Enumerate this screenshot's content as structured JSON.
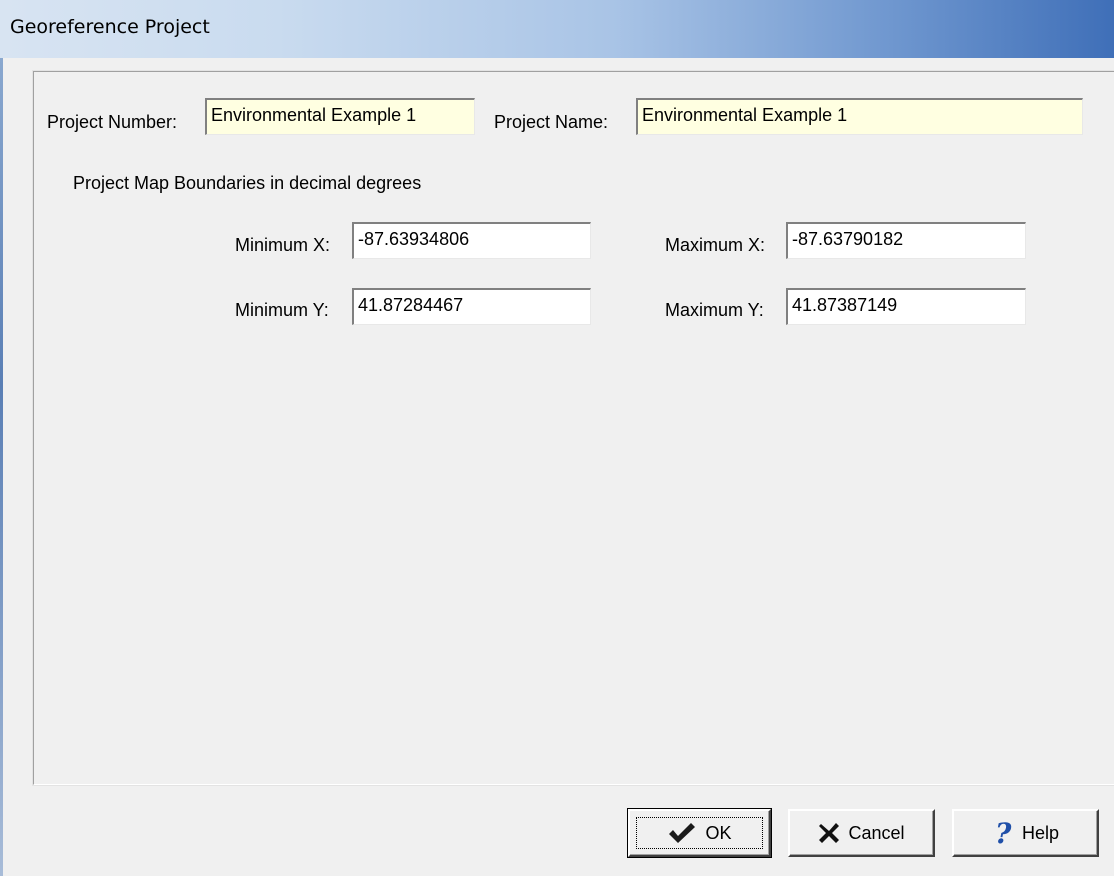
{
  "window": {
    "title": "Georeference Project"
  },
  "project": {
    "number_label": "Project Number:",
    "number_value": "Environmental Example 1",
    "name_label": "Project Name:",
    "name_value": "Environmental Example 1"
  },
  "boundaries": {
    "heading": "Project Map Boundaries in decimal degrees",
    "min_x_label": "Minimum X:",
    "min_x_value": "-87.63934806",
    "max_x_label": "Maximum X:",
    "max_x_value": "-87.63790182",
    "min_y_label": "Minimum Y:",
    "min_y_value": "41.87284467",
    "max_y_label": "Maximum Y:",
    "max_y_value": "41.87387149"
  },
  "buttons": {
    "ok_label": "OK",
    "ok_icon": "checkmark-icon",
    "cancel_label": "Cancel",
    "cancel_icon": "x-icon",
    "help_label": "Help",
    "help_icon": "question-icon"
  },
  "colors": {
    "title_gradient_end": "#3f6fb8",
    "field_yellow": "#ffffe1",
    "checkmark": "#1a1a1a",
    "help_icon": "#1f4fa8"
  }
}
